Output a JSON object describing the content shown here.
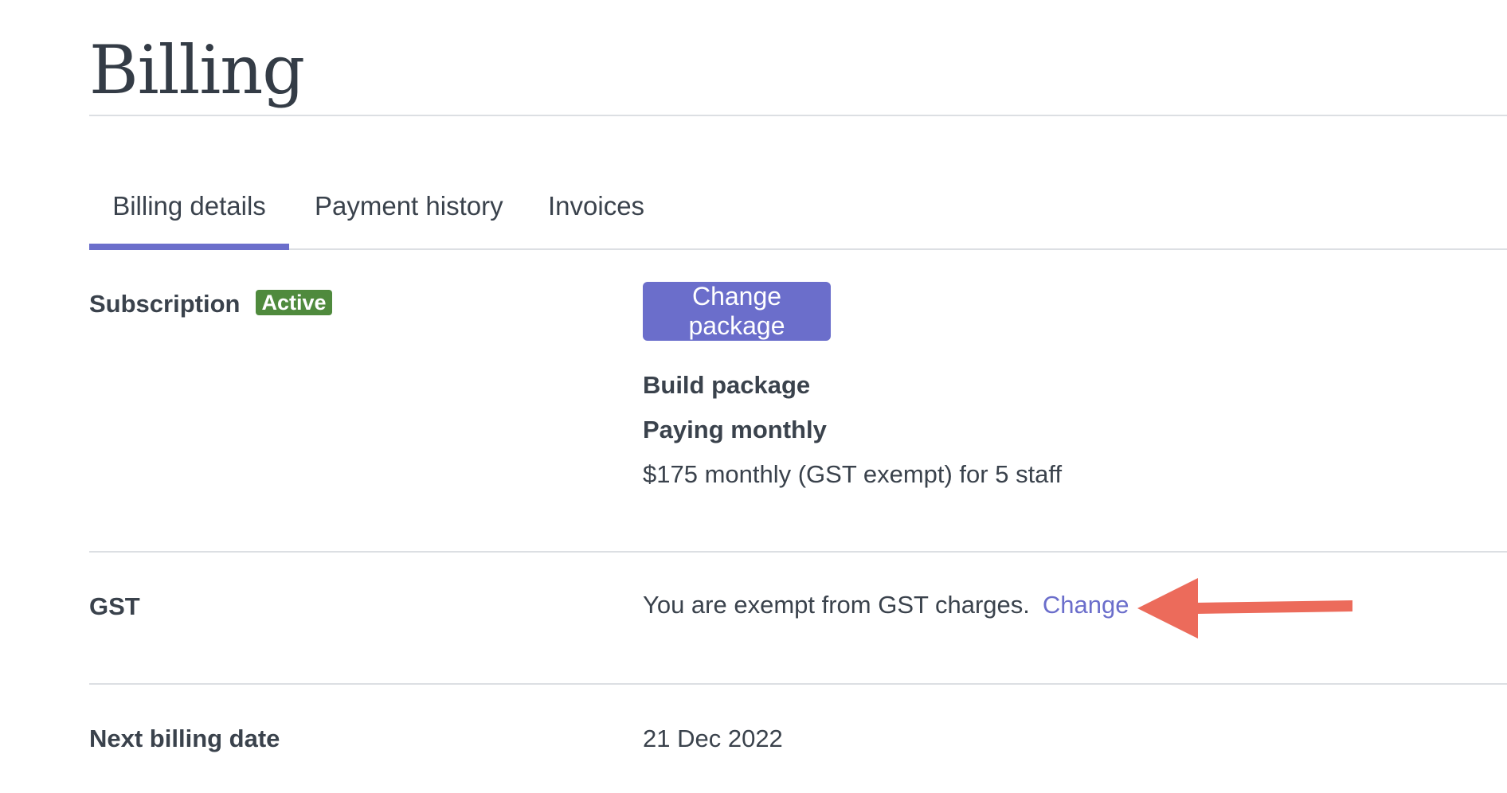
{
  "page": {
    "title": "Billing"
  },
  "tabs": [
    {
      "label": "Billing details",
      "active": true
    },
    {
      "label": "Payment history",
      "active": false
    },
    {
      "label": "Invoices",
      "active": false
    }
  ],
  "subscription": {
    "label": "Subscription",
    "status_badge": "Active",
    "change_button_label": "Change package",
    "package_name": "Build package",
    "billing_cycle": "Paying monthly",
    "price_summary": "$175 monthly (GST exempt) for 5 staff"
  },
  "gst": {
    "label": "GST",
    "text": "You are exempt from GST charges.",
    "change_link": "Change"
  },
  "next_billing": {
    "label": "Next billing date",
    "value": "21 Dec 2022"
  },
  "colors": {
    "accent": "#6b6ecb",
    "badge_active": "#4f8a3d",
    "annotation_arrow": "#ec6b5b",
    "text": "#3a424c",
    "divider": "#dcdfe3"
  },
  "icons": {
    "annotation": "arrow-left-icon"
  }
}
